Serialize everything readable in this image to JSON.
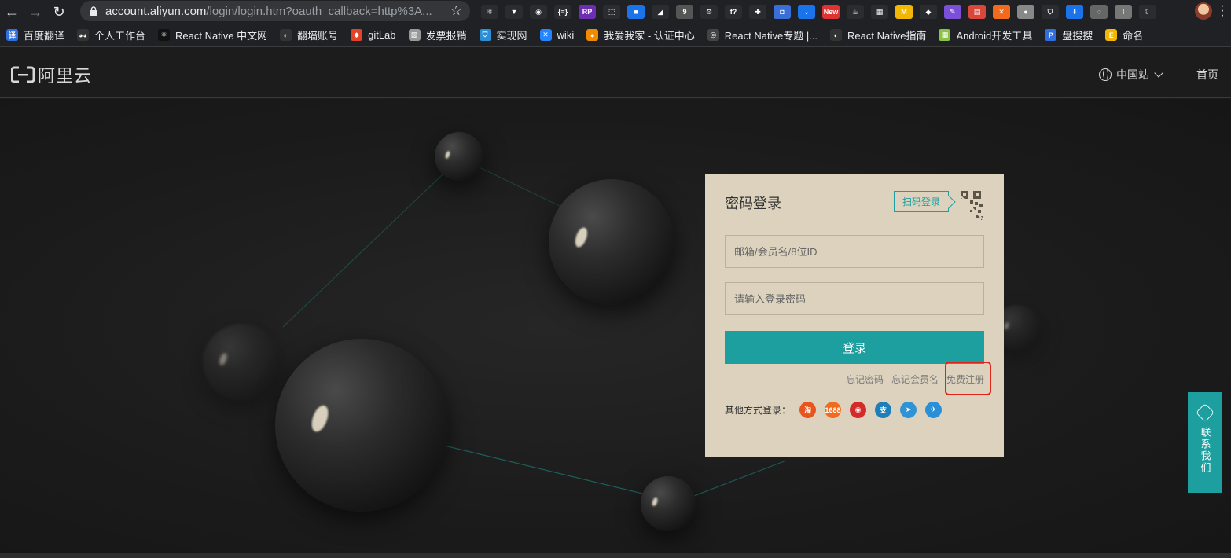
{
  "browser": {
    "url_host": "account.aliyun.com",
    "url_rest": "/login/login.htm?oauth_callback=http%3A...",
    "extensions": [
      {
        "name": "react-extension-icon",
        "color": "#2b2c30",
        "glyph": "⚛"
      },
      {
        "name": "vue-extension-icon",
        "color": "#2b2c30",
        "glyph": "▼"
      },
      {
        "name": "circle-extension-icon",
        "color": "#2b2c30",
        "glyph": "◉"
      },
      {
        "name": "json-extension-icon",
        "color": "#2b2c30",
        "glyph": "{≡}"
      },
      {
        "name": "rp-extension-icon",
        "color": "#6d2fb2",
        "glyph": "RP"
      },
      {
        "name": "crop-extension-icon",
        "color": "#2b2c30",
        "glyph": "⬚"
      },
      {
        "name": "square-extension-icon",
        "color": "#1a73e8",
        "glyph": "■"
      },
      {
        "name": "fox-extension-icon",
        "color": "#2b2c30",
        "glyph": "◢"
      },
      {
        "name": "database-extension-icon",
        "color": "#555",
        "glyph": "9"
      },
      {
        "name": "gear-extension-icon",
        "color": "#2b2c30",
        "glyph": "⚙"
      },
      {
        "name": "formula-extension-icon",
        "color": "#2b2c30",
        "glyph": "f?"
      },
      {
        "name": "ruler-extension-icon",
        "color": "#2b2c30",
        "glyph": "✚"
      },
      {
        "name": "camera-extension-icon",
        "color": "#3b6fd8",
        "glyph": "◘"
      },
      {
        "name": "pocket-extension-icon",
        "color": "#1a73e8",
        "glyph": "⌄"
      },
      {
        "name": "new-extension-icon",
        "color": "#d33",
        "glyph": "New"
      },
      {
        "name": "java-extension-icon",
        "color": "#2b2c30",
        "glyph": "☕"
      },
      {
        "name": "puzzle-extension-icon",
        "color": "#2b2c30",
        "glyph": "▦"
      },
      {
        "name": "m-extension-icon",
        "color": "#f2b705",
        "glyph": "M"
      },
      {
        "name": "diamond-extension-icon",
        "color": "#2b2c30",
        "glyph": "◆"
      },
      {
        "name": "feather-extension-icon",
        "color": "#7b4fd8",
        "glyph": "✎"
      },
      {
        "name": "chart-extension-icon",
        "color": "#d9473b",
        "glyph": "▤"
      },
      {
        "name": "orange-extension-icon",
        "color": "#f26b1d",
        "glyph": "✕"
      },
      {
        "name": "record-extension-icon",
        "color": "#888",
        "glyph": "●"
      },
      {
        "name": "shield-extension-icon",
        "color": "#2b2c30",
        "glyph": "⛉"
      },
      {
        "name": "download-extension-icon",
        "color": "#1a73e8",
        "glyph": "⬇"
      },
      {
        "name": "lens-extension-icon",
        "color": "#666",
        "glyph": "◌"
      },
      {
        "name": "alert-extension-icon",
        "color": "#777",
        "glyph": "!"
      },
      {
        "name": "moon-extension-icon",
        "color": "#2b2c30",
        "glyph": "☾"
      }
    ]
  },
  "bookmarks": [
    {
      "label": "百度翻译",
      "color": "#2f6fe0",
      "glyph": "译"
    },
    {
      "label": "个人工作台",
      "color": "#333",
      "glyph": "◕◕"
    },
    {
      "label": "React Native 中文网",
      "color": "#111",
      "glyph": "⚛"
    },
    {
      "label": "翻墙账号",
      "color": "#333",
      "glyph": "◐"
    },
    {
      "label": "gitLab",
      "color": "#e24329",
      "glyph": "◆"
    },
    {
      "label": "发票报销",
      "color": "#999",
      "glyph": "▧"
    },
    {
      "label": "实现网",
      "color": "#2a8fd6",
      "glyph": "⛉"
    },
    {
      "label": "wiki",
      "color": "#2684ff",
      "glyph": "✕"
    },
    {
      "label": "我爱我家 - 认证中心",
      "color": "#f08a00",
      "glyph": "●"
    },
    {
      "label": "React Native专题 |...",
      "color": "#444",
      "glyph": "◎"
    },
    {
      "label": "React Native指南",
      "color": "#333",
      "glyph": "◐"
    },
    {
      "label": "Android开发工具",
      "color": "#8bc34a",
      "glyph": "▦"
    },
    {
      "label": "盘搜搜",
      "color": "#2f6fe0",
      "glyph": "P"
    },
    {
      "label": "命名",
      "color": "#f2b705",
      "glyph": "E"
    }
  ],
  "header": {
    "logo_text": "阿里云",
    "region_label": "中国站",
    "home_label": "首页"
  },
  "login": {
    "title": "密码登录",
    "qr_tab_label": "扫码登录",
    "username_placeholder": "邮箱/会员名/8位ID",
    "password_placeholder": "请输入登录密码",
    "submit_label": "登录",
    "forgot_password": "忘记密码",
    "forgot_username": "忘记会员名",
    "register": "免费注册",
    "other_methods_label": "其他方式登录：",
    "social": [
      {
        "name": "taobao-login-icon",
        "color": "#e8541e",
        "glyph": "淘"
      },
      {
        "name": "1688-login-icon",
        "color": "#f06b1d",
        "glyph": "1688"
      },
      {
        "name": "weibo-login-icon",
        "color": "#d52a2a",
        "glyph": "◉"
      },
      {
        "name": "alipay-login-icon",
        "color": "#1e7fb8",
        "glyph": "支"
      },
      {
        "name": "dingtalk-login-icon",
        "color": "#2f93d6",
        "glyph": "➤"
      },
      {
        "name": "telegram-login-icon",
        "color": "#2a8fd6",
        "glyph": "✈"
      }
    ]
  },
  "contact": {
    "label": "联系我们"
  },
  "colors": {
    "accent": "#1d9e9f",
    "card_bg": "#dcd2bd",
    "highlight": "#e0241c"
  }
}
